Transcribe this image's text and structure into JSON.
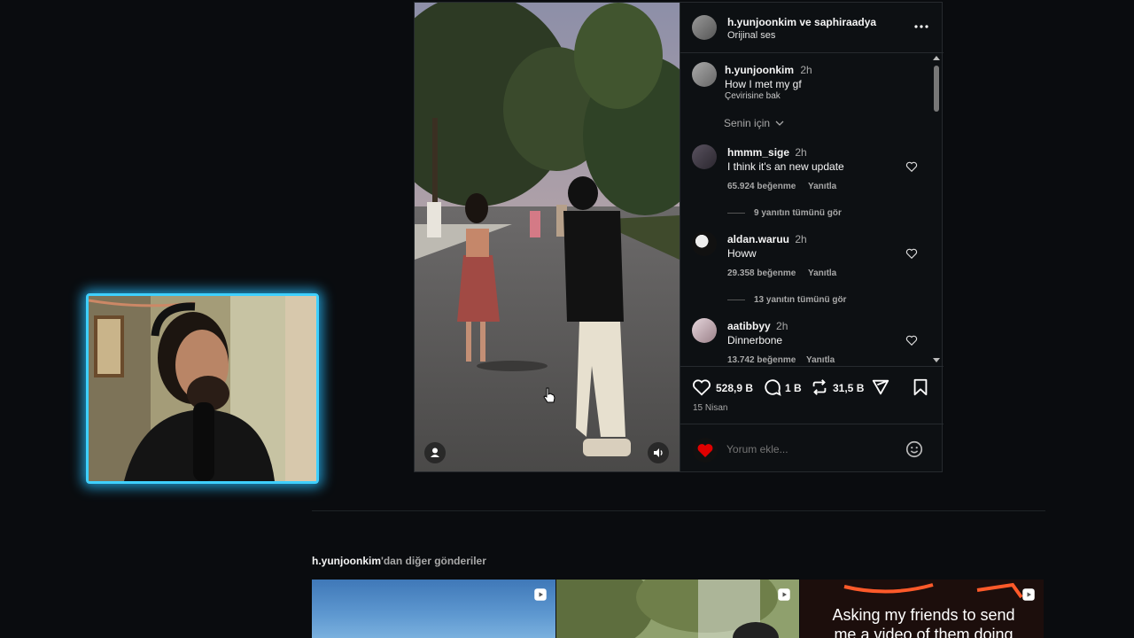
{
  "post": {
    "header": {
      "authors": "h.yunjoonkim ve saphiraadya",
      "audio": "Orijinal ses"
    },
    "caption": {
      "username": "h.yunjoonkim",
      "time": "2h",
      "text": "How I met my gf",
      "translate": "Çevirisine bak"
    },
    "sort_label": "Senin için",
    "comments": [
      {
        "username": "hmmm_sige",
        "time": "2h",
        "text": "I think it's an new update",
        "likes": "65.924 beğenme",
        "reply": "Yanıtla",
        "view_replies": "9 yanıtın tümünü gör"
      },
      {
        "username": "aldan.waruu",
        "time": "2h",
        "text": "Howw",
        "likes": "29.358 beğenme",
        "reply": "Yanıtla",
        "view_replies": "13 yanıtın tümünü gör"
      },
      {
        "username": "aatibbyy",
        "time": "2h",
        "text": "Dinnerbone",
        "likes": "13.742 beğenme",
        "reply": "Yanıtla"
      }
    ],
    "actions": {
      "likes": "528,9 B",
      "comments": "1 B",
      "reposts": "31,5 B"
    },
    "date": "15 Nisan",
    "comment_placeholder": "Yorum ekle..."
  },
  "more_posts": {
    "username": "h.yunjoonkim",
    "suffix": "'dan diğer gönderiler",
    "thumb3_text": "Asking my friends to send me a video of them doing this, except"
  },
  "colors": {
    "background": "#0a0c0f",
    "webcam_glow": "#3fd0ff",
    "card_border": "#262a2e"
  }
}
